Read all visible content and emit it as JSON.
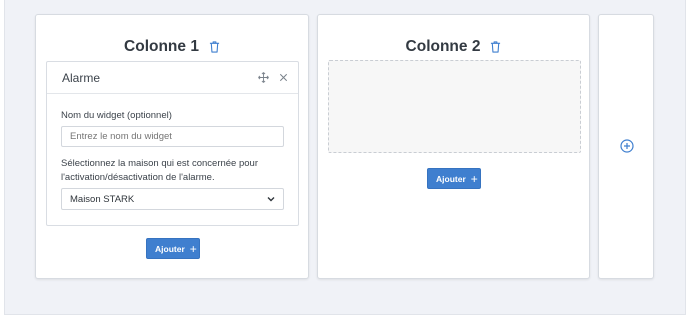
{
  "columns": [
    {
      "title": "Colonne 1",
      "widget": {
        "title": "Alarme",
        "name_label": "Nom du widget (optionnel)",
        "name_placeholder": "Entrez le nom du widget",
        "house_label": "Sélectionnez la maison qui est concernée pour l'activation/désactivation de l'alarme.",
        "house_selected": "Maison STARK"
      },
      "add_label": "Ajouter"
    },
    {
      "title": "Colonne 2",
      "add_label": "Ajouter"
    }
  ],
  "icons": {
    "delete": "trash-icon",
    "move": "move-icon",
    "close": "close-icon",
    "add": "plus-icon",
    "add_column": "plus-circle-icon",
    "select": "chevron-down-icon"
  },
  "colors": {
    "accent": "#3f7fcf",
    "page_background": "#f0f2f7"
  }
}
